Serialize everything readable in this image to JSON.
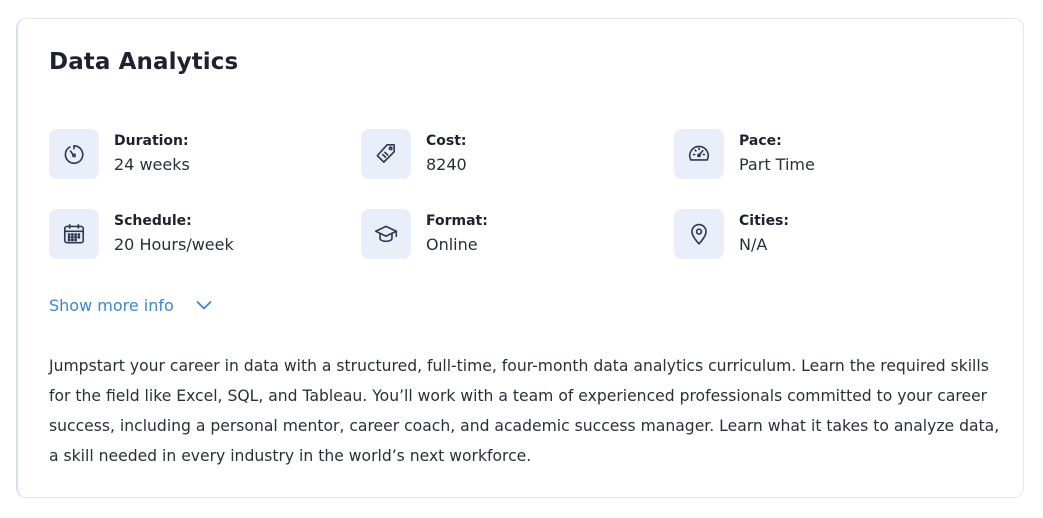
{
  "program": {
    "title": "Data Analytics",
    "stats": [
      {
        "icon": "timer-icon",
        "label": "Duration:",
        "value": "24 weeks"
      },
      {
        "icon": "price-tag-icon",
        "label": "Cost:",
        "value": "8240"
      },
      {
        "icon": "speedometer-icon",
        "label": "Pace:",
        "value": "Part Time"
      },
      {
        "icon": "calendar-icon",
        "label": "Schedule:",
        "value": "20 Hours/week"
      },
      {
        "icon": "graduation-cap-icon",
        "label": "Format:",
        "value": "Online"
      },
      {
        "icon": "map-pin-icon",
        "label": "Cities:",
        "value": "N/A"
      }
    ],
    "show_more_label": "Show more info",
    "description": "Jumpstart your career in data with a structured, full-time, four-month data analytics curriculum. Learn the required skills for the field like Excel, SQL, and Tableau. You’ll work with a team of experienced professionals committed to your career success, including a personal mentor, career coach, and academic success manager. Learn what it takes to analyze data, a skill needed in every industry in the world’s next workforce."
  },
  "colors": {
    "accent": "#3b86d6",
    "icon_background": "#e9eff8",
    "icon_stroke": "#2d3a52",
    "text": "#1e2230"
  }
}
